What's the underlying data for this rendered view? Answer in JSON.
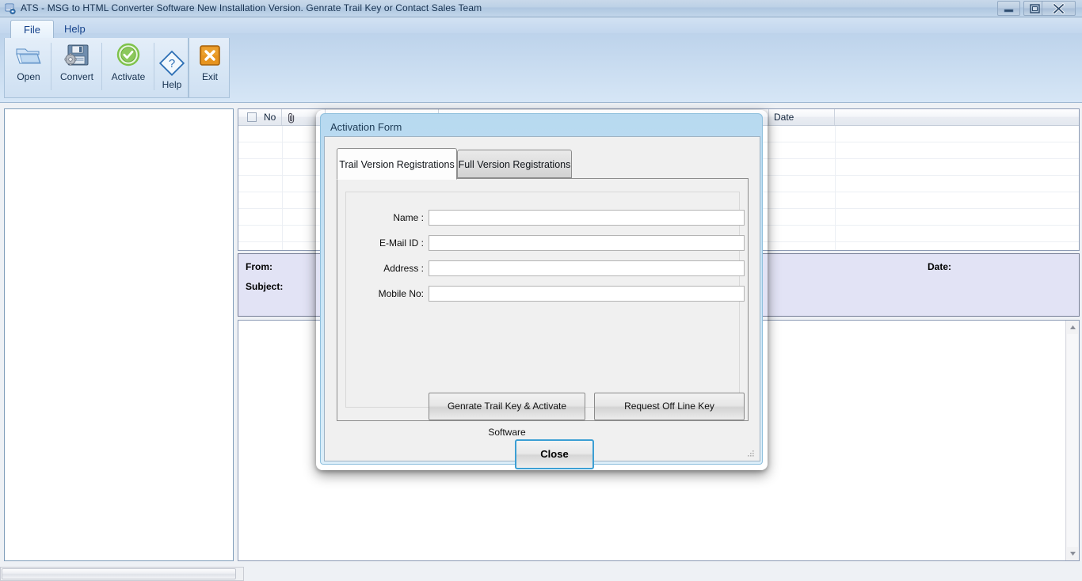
{
  "window": {
    "title": "ATS - MSG to HTML Converter Software New Installation Version. Genrate Trail Key or Contact Sales Team",
    "app_icon": "app-icon",
    "controls": {
      "minimize": "minimize-icon",
      "maximize": "restore-icon",
      "close": "close-icon"
    }
  },
  "ribbon": {
    "tabs": [
      {
        "label": "File",
        "active": true
      },
      {
        "label": "Help",
        "active": false
      }
    ],
    "buttons": [
      {
        "label": "Open",
        "icon": "folder-open-icon"
      },
      {
        "label": "Convert",
        "icon": "floppy-gear-icon"
      },
      {
        "label": "Activate",
        "icon": "green-check-circle-icon"
      },
      {
        "label": "Help",
        "icon": "blue-diamond-question-icon"
      },
      {
        "label": "Exit",
        "icon": "orange-x-icon"
      }
    ]
  },
  "grid": {
    "headers": [
      {
        "label": "",
        "name": "select-all-checkbox"
      },
      {
        "label": "No",
        "name": "column-no"
      },
      {
        "label": "",
        "name": "column-attachment"
      },
      {
        "label": "",
        "name": "column-blank-3"
      },
      {
        "label": "",
        "name": "column-blank-4"
      },
      {
        "label": "Date",
        "name": "column-date"
      },
      {
        "label": "",
        "name": "column-blank-6"
      }
    ],
    "rows": []
  },
  "info_panel": {
    "from_label": "From:",
    "subject_label": "Subject:",
    "date_label": "Date:"
  },
  "dialog": {
    "title": "Activation Form",
    "tabs": [
      {
        "label": "Trail Version Registrations",
        "active": true
      },
      {
        "label": "Full Version Registrations",
        "active": false
      }
    ],
    "fields": [
      {
        "label": "Name :",
        "value": "",
        "placeholder": "",
        "name": "name-field"
      },
      {
        "label": "E-Mail ID :",
        "value": "",
        "placeholder": "",
        "name": "email-field"
      },
      {
        "label": "Address :",
        "value": "",
        "placeholder": "",
        "name": "address-field"
      },
      {
        "label": "Mobile No:",
        "value": "",
        "placeholder": "",
        "name": "mobile-field"
      }
    ],
    "buttons": {
      "generate": "Genrate Trail Key & Activate Software",
      "offline": "Request Off Line Key",
      "close": "Close"
    }
  },
  "colors": {
    "titlebar_text": "#16314f",
    "ribbon_tab_text": "#15428b",
    "info_panel_bg": "#e2e3f5",
    "dialog_border": "#8fc0dd",
    "focus_border": "#3c9fd4",
    "exit_icon": "#e08214",
    "activate_icon": "#76c043"
  }
}
